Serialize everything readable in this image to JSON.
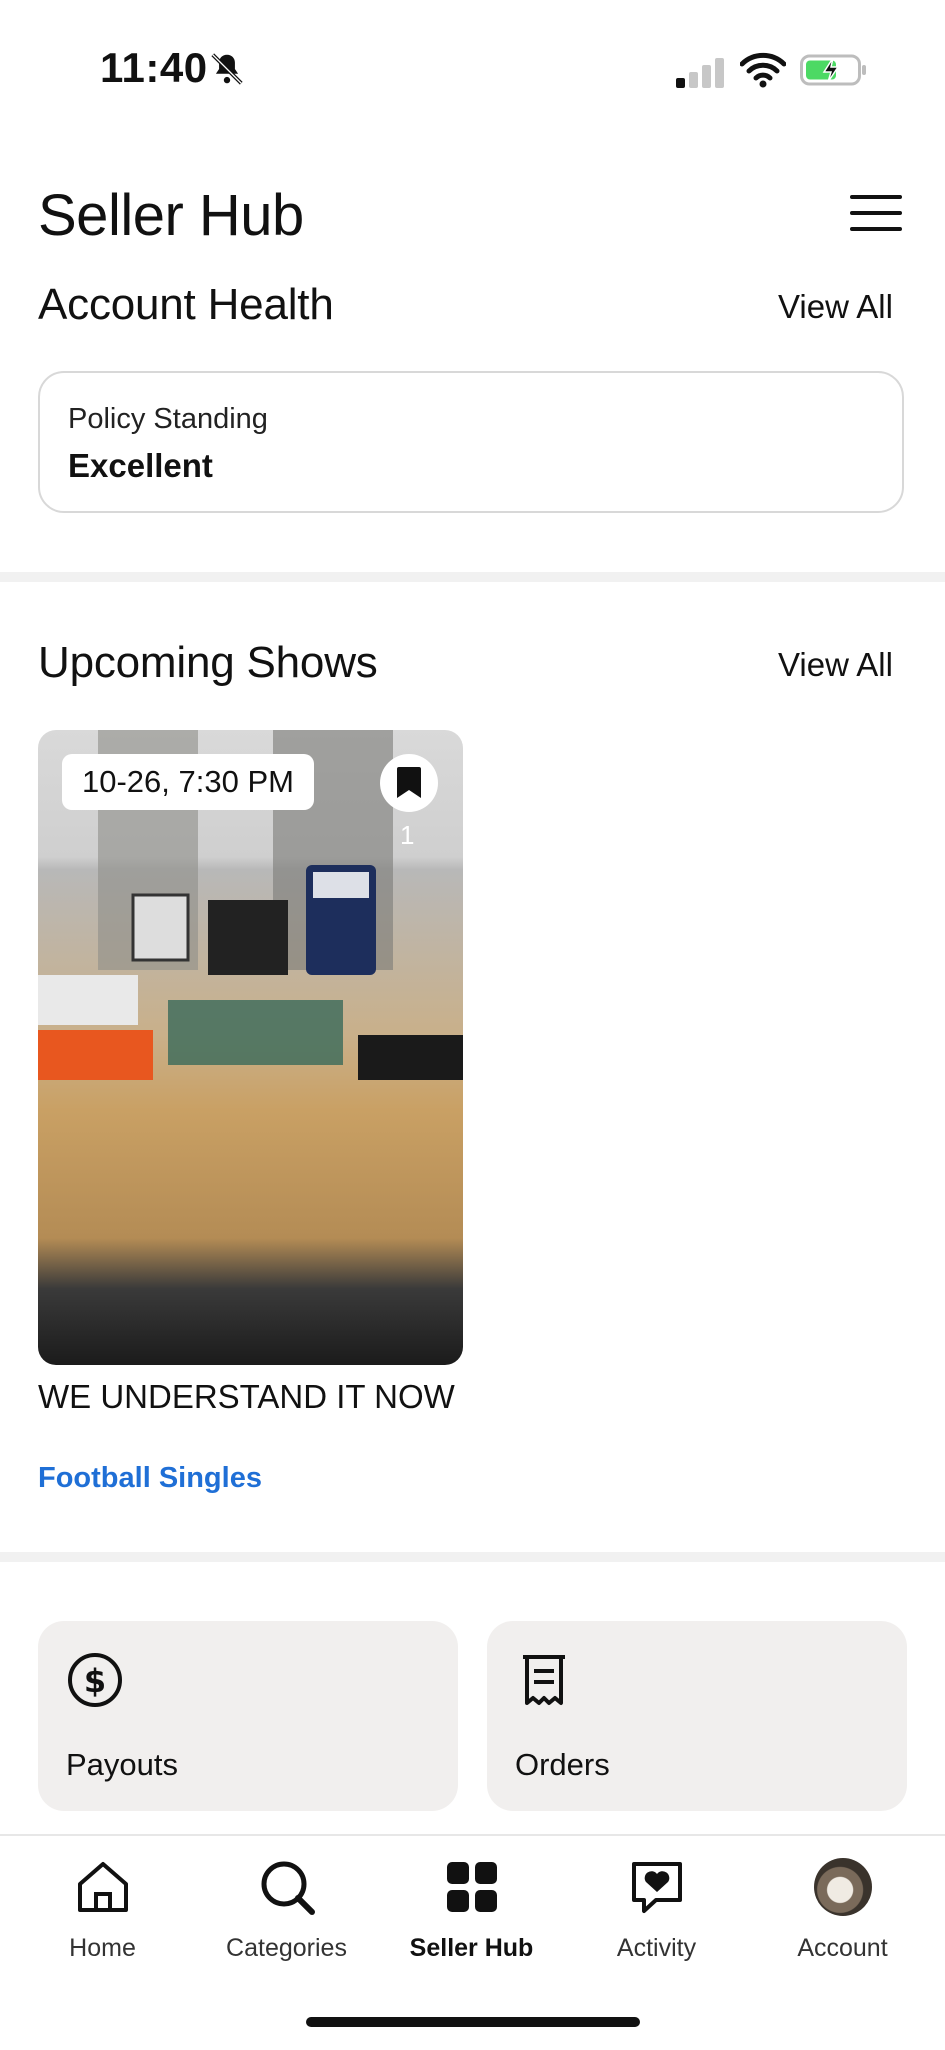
{
  "status_bar": {
    "time": "11:40"
  },
  "header": {
    "title": "Seller Hub"
  },
  "account_health": {
    "title": "Account Health",
    "view_all": "View All",
    "policy_label": "Policy Standing",
    "policy_value": "Excellent"
  },
  "upcoming_shows": {
    "title": "Upcoming Shows",
    "view_all": "View All",
    "shows": [
      {
        "date_time": "10-26, 7:30 PM",
        "bookmark_count": "1",
        "title": "WE UNDERSTAND IT NOW",
        "category": "Football Singles"
      }
    ]
  },
  "tiles": [
    {
      "label": "Payouts",
      "icon": "dollar-circle-icon"
    },
    {
      "label": "Orders",
      "icon": "receipt-icon"
    }
  ],
  "tabbar": {
    "items": [
      {
        "label": "Home",
        "icon": "home-icon"
      },
      {
        "label": "Categories",
        "icon": "search-icon"
      },
      {
        "label": "Seller Hub",
        "icon": "grid-icon",
        "active": true
      },
      {
        "label": "Activity",
        "icon": "heart-chat-icon"
      },
      {
        "label": "Account",
        "icon": "avatar"
      }
    ]
  },
  "colors": {
    "link": "#1f6fd6",
    "tile_bg": "#f1efee",
    "battery_green": "#4cd964"
  }
}
